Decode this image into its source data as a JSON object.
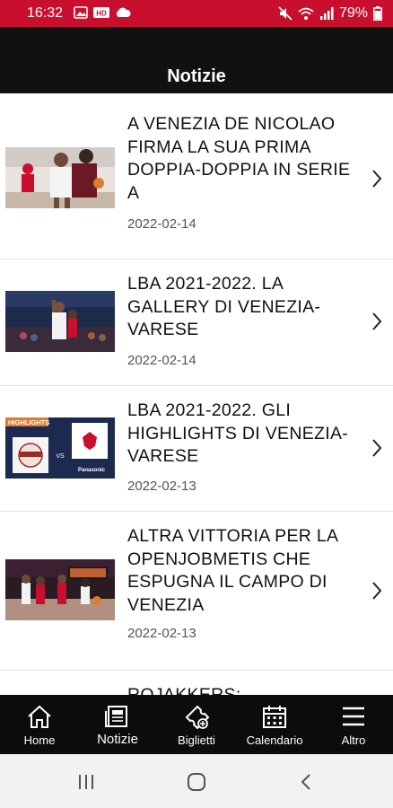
{
  "status": {
    "time": "16:32",
    "battery": "79%"
  },
  "header": {
    "title": "Notizie"
  },
  "news": [
    {
      "title": "A VENEZIA DE NICOLAO FIRMA LA SUA PRIMA DOPPIA-DOPPIA IN SERIE A",
      "date": "2022-02-14"
    },
    {
      "title": "LBA 2021-2022. LA GALLERY DI VENEZIA-VARESE",
      "date": "2022-02-14"
    },
    {
      "title": "LBA 2021-2022. GLI HIGHLIGHTS DI VENEZIA-VARESE",
      "date": "2022-02-13"
    },
    {
      "title": "ALTRA VITTORIA PER LA OPENJOBMETIS CHE ESPUGNA IL CAMPO DI VENEZIA",
      "date": "2022-02-13"
    },
    {
      "title": "ROJAKKERS:"
    }
  ],
  "thumb3": {
    "banner": "HIGHLIGHTS",
    "vs": "VS",
    "sponsor": "Panasonic"
  },
  "nav": {
    "home": "Home",
    "notizie": "Notizie",
    "biglietti": "Biglietti",
    "calendario": "Calendario",
    "altro": "Altro"
  },
  "colors": {
    "status_bar": "#c8102e",
    "header": "#111111",
    "nav": "#0c0c0c"
  }
}
